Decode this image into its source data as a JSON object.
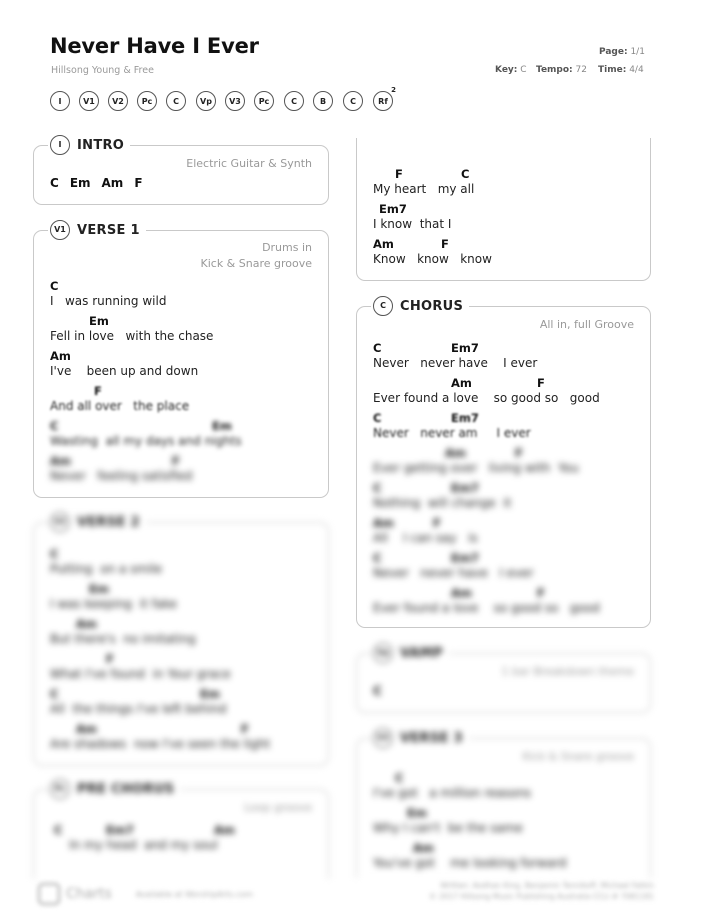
{
  "song": {
    "title": "Never Have I Ever",
    "artist": "Hillsong Young & Free",
    "page_label": "Page:",
    "page_value": "1/1",
    "key_label": "Key:",
    "key_value": "C",
    "tempo_label": "Tempo:",
    "tempo_value": "72",
    "time_label": "Time:",
    "time_value": "4/4"
  },
  "roadmap": [
    "I",
    "V1",
    "V2",
    "Pc",
    "C",
    "Vp",
    "V3",
    "Pc",
    "C",
    "B",
    "C",
    "Rf"
  ],
  "roadmap_rf_repeat": "2",
  "intro": {
    "badge": "I",
    "name": "INTRO",
    "note": "Electric Guitar & Synth",
    "chords": [
      "C",
      "Em",
      "Am",
      "F"
    ]
  },
  "verse1": {
    "badge": "V1",
    "name": "VERSE 1",
    "note1": "Drums in",
    "note2": "Kick & Snare groove",
    "lines": [
      {
        "chords": [
          "C"
        ],
        "lyric": "I   was running wild"
      },
      {
        "chords": [
          "Em"
        ],
        "lyric": "Fell in love   with the chase"
      },
      {
        "chords": [
          "Am"
        ],
        "lyric": "I've    been up and down"
      },
      {
        "chords": [
          "F"
        ],
        "lyric": "And all over   the place"
      },
      {
        "chords": [
          "C",
          "Em"
        ],
        "lyric": "Wasting  all my days and nights"
      },
      {
        "chords": [
          "Am",
          "F"
        ],
        "lyric": "Never   feeling satisfied"
      }
    ]
  },
  "verse2": {
    "badge": "V2",
    "name": "VERSE 2",
    "lines": [
      {
        "chords": [
          "C"
        ],
        "lyric": "Putting  on a smile"
      },
      {
        "chords": [
          "Em"
        ],
        "lyric": "I was keeping  it fake"
      },
      {
        "chords": [
          "Am"
        ],
        "lyric": "But there's  no imitating"
      },
      {
        "chords": [
          "F"
        ],
        "lyric": "What I've found  in Your grace"
      },
      {
        "chords": [
          "C",
          "Em"
        ],
        "lyric": "All  the things I've left behind"
      },
      {
        "chords": [
          "Am",
          "F"
        ],
        "lyric": "Are shadows  now I've seen the light"
      }
    ]
  },
  "prechorus": {
    "badge": "Pc",
    "name": "PRE CHORUS",
    "note": "Loop groove",
    "lines": [
      {
        "chords": [
          "C",
          "Em7",
          "Am"
        ],
        "lyric": "     In my head  and my soul"
      }
    ]
  },
  "pc_cont": {
    "lines": [
      {
        "chords": [
          "F",
          "C"
        ],
        "lyric": "My heart   my all"
      },
      {
        "chords": [
          "Em7"
        ],
        "lyric": "I know  that I"
      },
      {
        "chords": [
          "Am",
          "F"
        ],
        "lyric": "Know   know   know"
      }
    ]
  },
  "chorus": {
    "badge": "C",
    "name": "CHORUS",
    "note": "All in, full Groove",
    "lines": [
      {
        "chords": [
          "C",
          "Em7"
        ],
        "lyric": "Never   never have    I ever"
      },
      {
        "chords": [
          "Am",
          "F"
        ],
        "lyric": "Ever found a love    so good so   good"
      },
      {
        "chords": [
          "C",
          "Em7"
        ],
        "lyric": "Never   never am     I ever"
      },
      {
        "chords": [
          "Am",
          "F"
        ],
        "lyric": "Ever getting over   living with  You"
      },
      {
        "chords": [
          "C",
          "Em7"
        ],
        "lyric": "Nothing  will change  it"
      },
      {
        "chords": [
          "Am",
          "F"
        ],
        "lyric": "All    I can say   is"
      },
      {
        "chords": [
          "C",
          "Em7"
        ],
        "lyric": "Never   never have   I ever"
      },
      {
        "chords": [
          "Am",
          "F"
        ],
        "lyric": "Ever found a love    so good so   good"
      }
    ]
  },
  "vamp": {
    "badge": "Vp",
    "name": "VAMP",
    "note": "1 bar Breakdown theme",
    "chords": [
      "C"
    ]
  },
  "verse3": {
    "badge": "V3",
    "name": "VERSE 3",
    "note": "Kick & Snare groove",
    "lines": [
      {
        "chords": [
          "C"
        ],
        "lyric": "I've got   a million reasons"
      },
      {
        "chords": [
          "Em"
        ],
        "lyric": "Why I can't  be the same"
      },
      {
        "chords": [
          "Am"
        ],
        "lyric": "You've got    me looking forward"
      }
    ]
  },
  "footer": {
    "brand": "Charts",
    "left_text": "Available at WorshipArts.com",
    "right1": "Written: Aodhan King, Benjamin Tennikoff, Michael Fatkin",
    "right2": "© 2017 Hillsong Music Publishing Australia  CCLI # 7081181"
  }
}
